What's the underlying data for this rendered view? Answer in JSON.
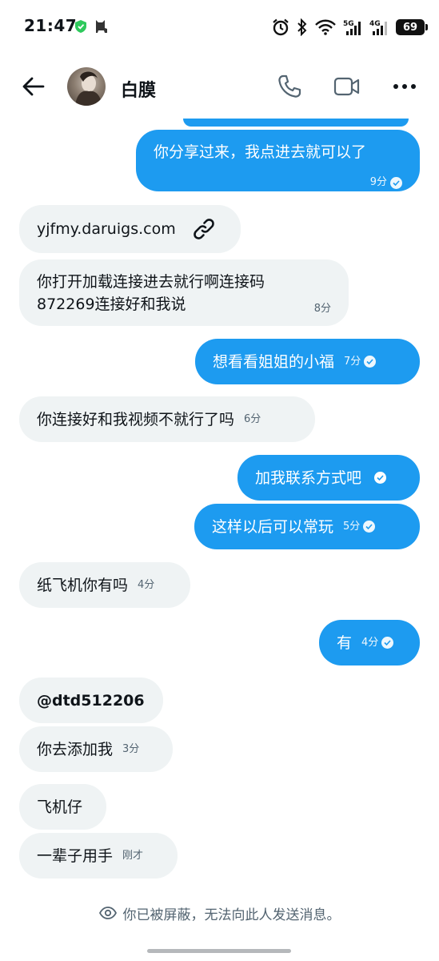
{
  "status_bar": {
    "time": "21:47",
    "battery": "69",
    "net1": "5G",
    "net2": "4G"
  },
  "header": {
    "contact_name": "白膜"
  },
  "messages": [
    {
      "id": "m1",
      "text": "你分享过来，我点进去就可以了",
      "time": "9分"
    },
    {
      "id": "m2",
      "text": "yjfmy.daruigs.com"
    },
    {
      "id": "m3",
      "line1": "你打开加载连接进去就行啊连接码",
      "line2": "872269连接好和我说",
      "time": "8分"
    },
    {
      "id": "m4",
      "text": "想看看姐姐的小福",
      "time": "7分"
    },
    {
      "id": "m5",
      "text": "你连接好和我视频不就行了吗",
      "time": "6分"
    },
    {
      "id": "m6",
      "text": "加我联系方式吧"
    },
    {
      "id": "m7",
      "text": "这样以后可以常玩",
      "time": "5分"
    },
    {
      "id": "m8",
      "text": "纸飞机你有吗",
      "time": "4分"
    },
    {
      "id": "m9",
      "text": "有",
      "time": "4分"
    },
    {
      "id": "m10",
      "text": "@dtd512206"
    },
    {
      "id": "m11",
      "text": "你去添加我",
      "time": "3分"
    },
    {
      "id": "m12",
      "text": "飞机仔"
    },
    {
      "id": "m13",
      "text": "一辈子用手",
      "time": "刚才"
    }
  ],
  "footer": {
    "blocked_notice": "你已被屏蔽，无法向此人发送消息。"
  },
  "colors": {
    "accent": "#1d9bf0",
    "incoming_bg": "#eff3f4",
    "muted_text": "#536471"
  },
  "icons": [
    "back-arrow-icon",
    "phone-icon",
    "video-camera-icon",
    "more-icon",
    "link-icon",
    "read-check-icon",
    "eye-icon"
  ]
}
